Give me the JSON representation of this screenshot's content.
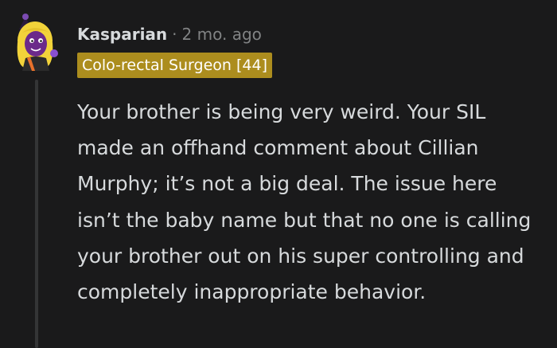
{
  "comment": {
    "author": "Kasparian",
    "separator": "·",
    "time": "2 mo. ago",
    "flair": "Colo-rectal Surgeon [44]",
    "body": "Your brother is being very weird. Your SIL made an offhand comment about Cillian Murphy; it’s not a big deal. The issue here isn’t the baby name but that no one is calling your brother out on his super controlling and completely inappropriate behavior."
  },
  "colors": {
    "background": "#1a1a1b",
    "text": "#d7dadc",
    "muted": "#818384",
    "flair_bg": "#ac8d1e",
    "thread_line": "#343536"
  },
  "icons": {
    "avatar": "user-avatar-icon"
  }
}
